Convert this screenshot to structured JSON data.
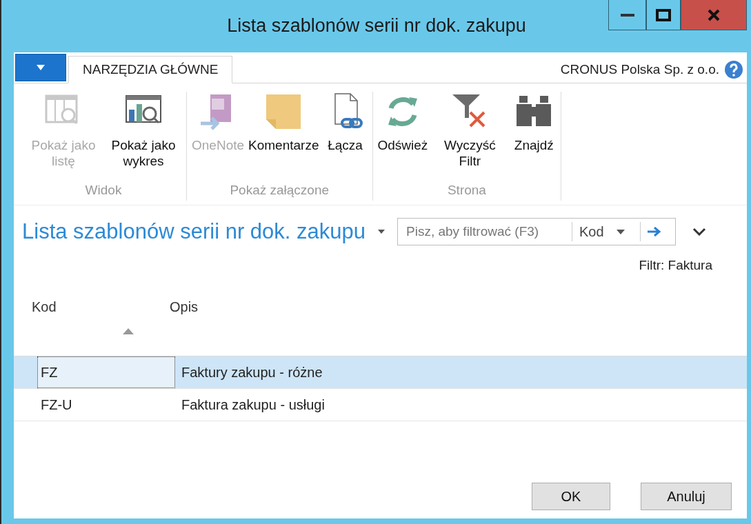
{
  "window": {
    "title": "Lista szablonów serii nr dok. zakupu"
  },
  "ribbon": {
    "tabs": [
      {
        "label": "NARZĘDZIA GŁÓWNE",
        "selected": true
      }
    ],
    "company": "CRONUS Polska Sp. z o.o.",
    "groups": [
      {
        "label": "Widok",
        "buttons": [
          {
            "kind": "list",
            "label": "Pokaż jako listę",
            "disabled": true
          },
          {
            "kind": "chart",
            "label": "Pokaż jako wykres",
            "disabled": false
          }
        ]
      },
      {
        "label": "Pokaż załączone",
        "buttons": [
          {
            "kind": "onenote",
            "label": "OneNote",
            "disabled": true
          },
          {
            "kind": "note",
            "label": "Komentarze",
            "disabled": false
          },
          {
            "kind": "link",
            "label": "Łącza",
            "disabled": false
          }
        ]
      },
      {
        "label": "Strona",
        "buttons": [
          {
            "kind": "refresh",
            "label": "Odśwież",
            "disabled": false
          },
          {
            "kind": "clearfilter",
            "label": "Wyczyść Filtr",
            "disabled": false
          },
          {
            "kind": "find",
            "label": "Znajdź",
            "disabled": false
          }
        ]
      }
    ]
  },
  "page": {
    "title": "Lista szablonów serii nr dok. zakupu",
    "filter": {
      "placeholder": "Pisz, aby filtrować (F3)",
      "field": "Kod"
    },
    "filter_note": "Filtr: Faktura"
  },
  "table": {
    "columns": [
      {
        "label": "Kod",
        "sorted": true
      },
      {
        "label": "Opis",
        "sorted": false
      }
    ],
    "rows": [
      {
        "code": "FZ",
        "description": "Faktury zakupu - różne",
        "selected": true
      },
      {
        "code": "FZ-U",
        "description": "Faktura zakupu - usługi",
        "selected": false
      }
    ]
  },
  "buttons": [
    "OK",
    "Anuluj"
  ]
}
